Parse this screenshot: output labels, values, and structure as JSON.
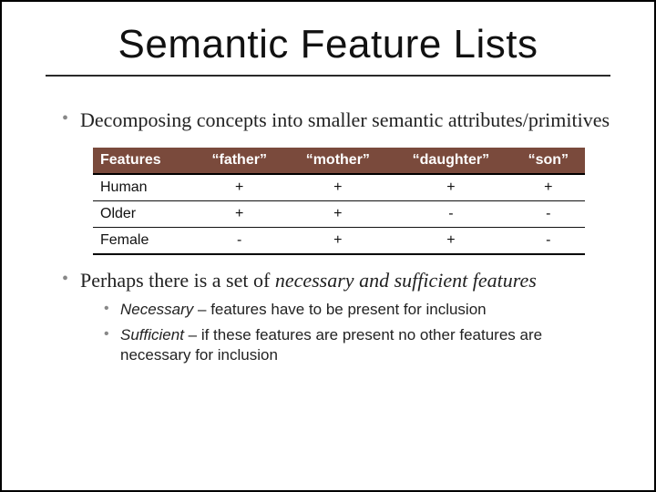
{
  "title": "Semantic Feature Lists",
  "bullets": {
    "b1": "Decomposing concepts into smaller semantic attributes/primitives",
    "b2_pre": "Perhaps there is a set of ",
    "b2_em": "necessary and sufficient features",
    "b2a_em": "Necessary",
    "b2a_rest": " – features have to be present for inclusion",
    "b2b_em": "Sufficient",
    "b2b_rest": " – if these features are present no other features are necessary for inclusion"
  },
  "table": {
    "headers": [
      "Features",
      "“father”",
      "“mother”",
      "“daughter”",
      "“son”"
    ],
    "rows": [
      [
        "Human",
        "+",
        "+",
        "+",
        "+"
      ],
      [
        "Older",
        "+",
        "+",
        "-",
        "-"
      ],
      [
        "Female",
        "-",
        "+",
        "+",
        "-"
      ]
    ]
  },
  "chart_data": {
    "type": "table",
    "title": "Semantic Feature Lists",
    "columns": [
      "Features",
      "father",
      "mother",
      "daughter",
      "son"
    ],
    "rows": [
      {
        "Features": "Human",
        "father": "+",
        "mother": "+",
        "daughter": "+",
        "son": "+"
      },
      {
        "Features": "Older",
        "father": "+",
        "mother": "+",
        "daughter": "-",
        "son": "-"
      },
      {
        "Features": "Female",
        "father": "-",
        "mother": "+",
        "daughter": "+",
        "son": "-"
      }
    ]
  }
}
